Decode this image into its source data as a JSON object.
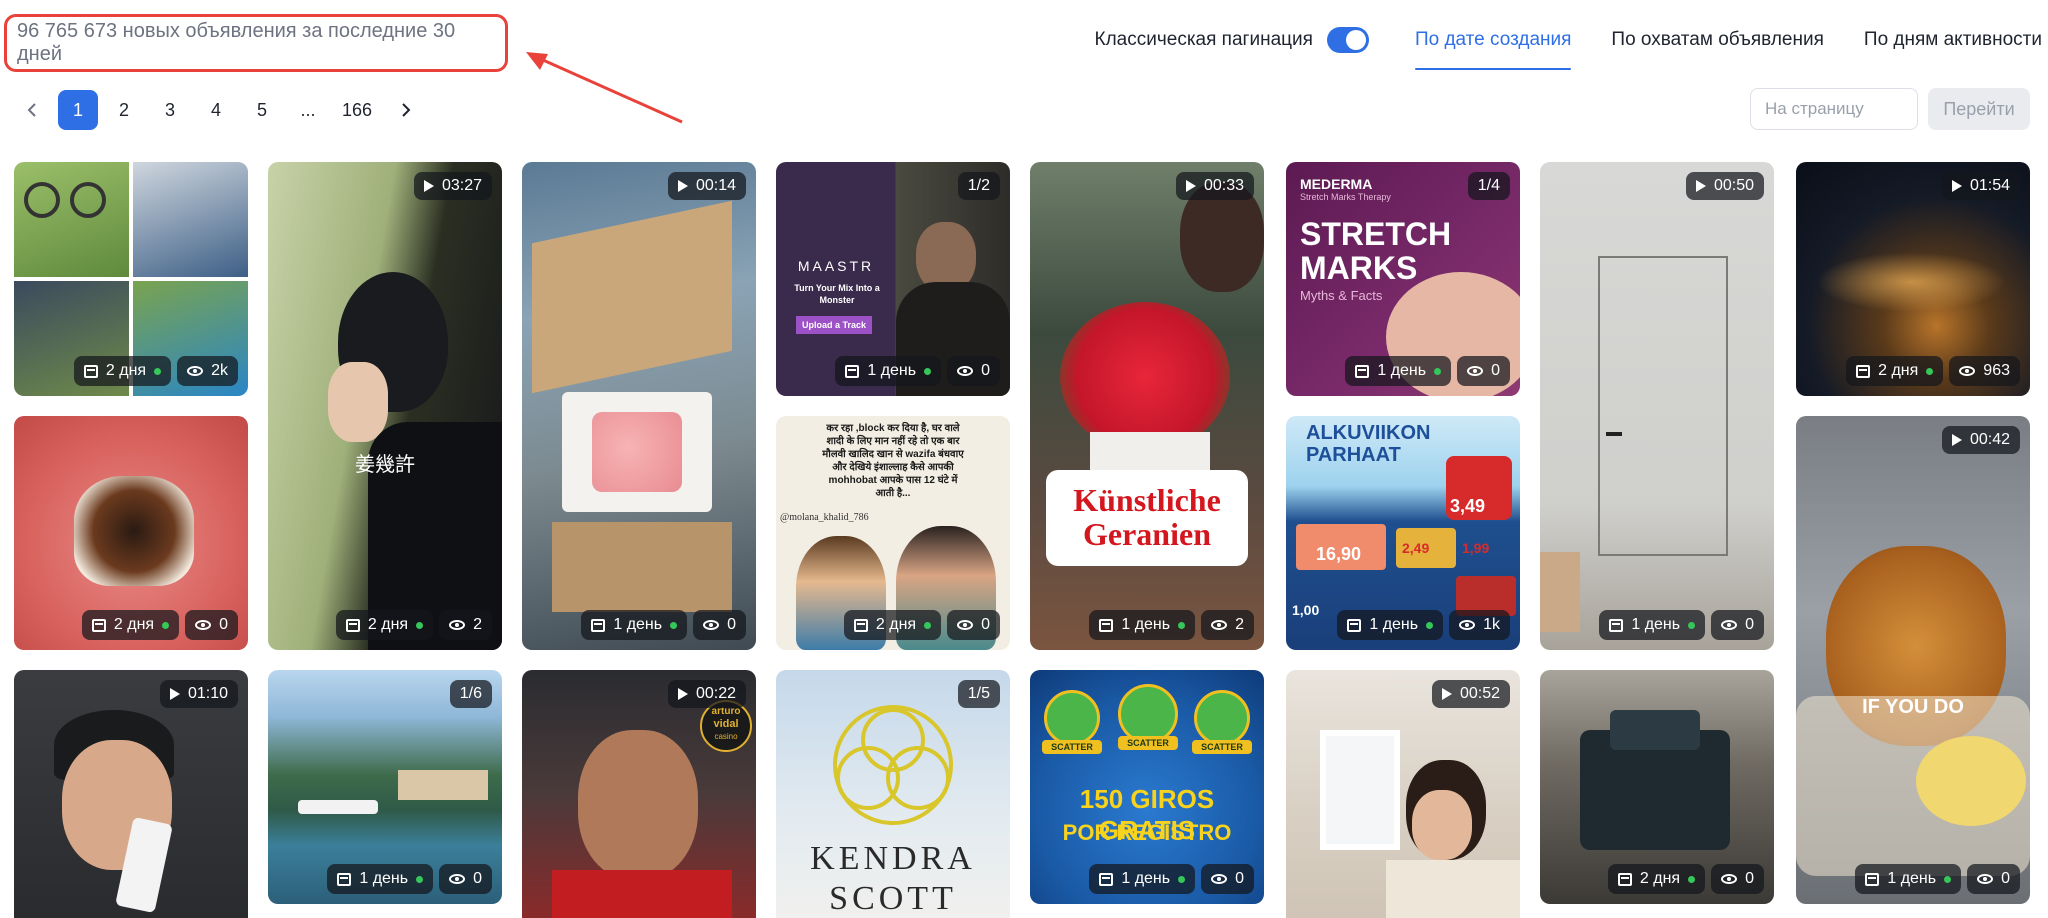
{
  "header": {
    "ad_count_text": "96 765 673 новых объявления за последние 30 дней",
    "toggle_label": "Классическая пагинация",
    "toggle_on": true,
    "sort_tabs": [
      {
        "label": "По дате создания",
        "active": true
      },
      {
        "label": "По охватам объявления",
        "active": false
      },
      {
        "label": "По дням активности",
        "active": false
      }
    ]
  },
  "pagination": {
    "pages": [
      "1",
      "2",
      "3",
      "4",
      "5",
      "...",
      "166"
    ],
    "current_page": "1",
    "prev_icon": "chevron-left-icon",
    "next_icon": "chevron-right-icon",
    "goto_placeholder": "На страницу",
    "goto_button": "Перейти"
  },
  "cards": [
    {
      "id": "c1",
      "age": "2 дня",
      "views": "2k"
    },
    {
      "id": "c2",
      "duration": "03:27",
      "age": "2 дня",
      "views": "2",
      "caption": "姜幾許"
    },
    {
      "id": "c3",
      "duration": "00:14",
      "age": "1 день",
      "views": "0"
    },
    {
      "id": "c4",
      "counter": "1/2",
      "age": "1 день",
      "views": "0",
      "brand": "MAASTR",
      "tagline": "Turn Your Mix Into a Monster",
      "cta": "Upload a Track"
    },
    {
      "id": "c5",
      "duration": "00:33",
      "age": "1 день",
      "views": "2",
      "caption_line1": "Künstliche",
      "caption_line2": "Geranien"
    },
    {
      "id": "c6",
      "counter": "1/4",
      "age": "1 день",
      "views": "0",
      "brand": "MEDERMA",
      "sub": "Stretch Marks Therapy",
      "title_line1": "STRETCH",
      "title_line2": "MARKS",
      "tagline": "Myths & Facts"
    },
    {
      "id": "c7",
      "duration": "00:50",
      "age": "1 день",
      "views": "0"
    },
    {
      "id": "c8",
      "duration": "01:54",
      "age": "2 дня",
      "views": "963"
    },
    {
      "id": "c9",
      "age": "2 дня",
      "views": "0"
    },
    {
      "id": "c10",
      "age": "2 дня",
      "views": "0",
      "text_line1": "कर रहा ,block कर दिया है, घर वाले",
      "text_line2": "शादी के लिए मान नहीं रहे तो एक बार",
      "text_line3": "मौलवी खालिद खान से wazifa बंधवाए",
      "text_line4": "और देखिये इंशाल्लाह कैसे आपकी",
      "text_line5": "mohhobat आपके पास 12 घंटे में",
      "text_line6": "आती है...",
      "handle": "@molana_khalid_786"
    },
    {
      "id": "c11",
      "age": "1 день",
      "views": "1k",
      "title_line1": "ALKUVIIKON",
      "title_line2": "PARHAAT",
      "price1": "3,49",
      "price2": "16,90",
      "price3": "2,49",
      "price4": "1,99",
      "price5": "1,00"
    },
    {
      "id": "c12",
      "duration": "00:42",
      "age": "1 день",
      "views": "0",
      "caption": "IF YOU DO"
    },
    {
      "id": "c13",
      "duration": "01:10"
    },
    {
      "id": "c14",
      "counter": "1/6",
      "age": "1 день",
      "views": "0"
    },
    {
      "id": "c15",
      "duration": "00:22",
      "logo_line1": "arturo",
      "logo_line2": "vidal",
      "logo_line3": "casino"
    },
    {
      "id": "c16",
      "counter": "1/5",
      "brand_line1": "KENDRA",
      "brand_line2": "SCOTT"
    },
    {
      "id": "c17",
      "age": "1 день",
      "views": "0",
      "scatter": "SCATTER",
      "promo_line1": "150 GIROS GRATIS",
      "promo_line2": "POR REGISTRO"
    },
    {
      "id": "c18",
      "duration": "00:52"
    },
    {
      "id": "c19",
      "age": "2 дня",
      "views": "0"
    }
  ],
  "colors": {
    "accent": "#2f6fe6",
    "annotation": "#e8423a",
    "online_dot": "#35c759"
  }
}
